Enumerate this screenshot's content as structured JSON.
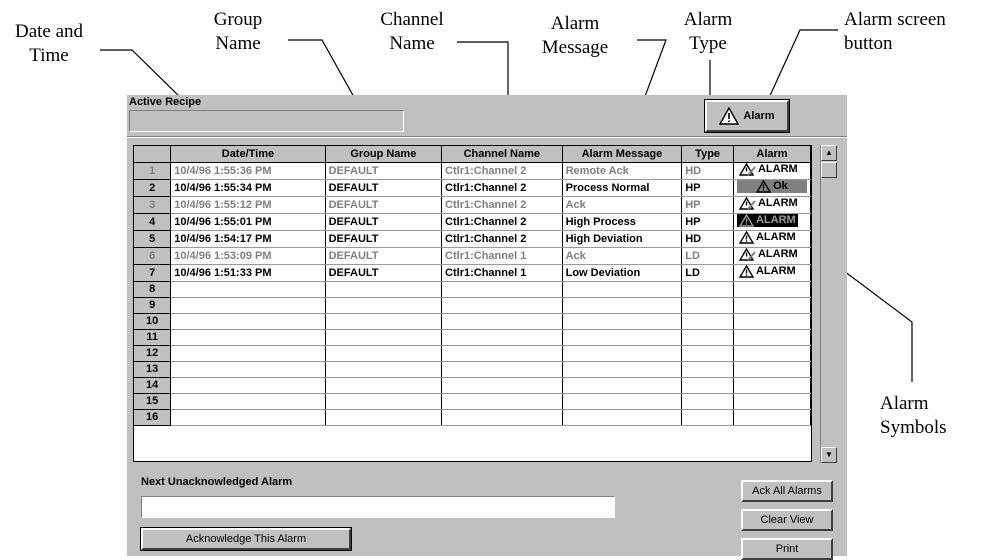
{
  "callouts": {
    "date_time": "Date and Time",
    "group_name": "Group Name",
    "channel_name": "Channel Name",
    "alarm_message": "Alarm Message",
    "alarm_type": "Alarm Type",
    "alarm_screen_button": "Alarm screen button",
    "alarm_symbols": "Alarm Symbols"
  },
  "recipe": {
    "label": "Active Recipe",
    "value": ""
  },
  "alarm_button": {
    "label": "Alarm",
    "icon": "warning-triangle-icon"
  },
  "table": {
    "columns": [
      "",
      "Date/Time",
      "Group Name",
      "Channel Name",
      "Alarm Message",
      "Type",
      "Alarm"
    ],
    "rows": [
      {
        "n": "1",
        "datetime": "10/4/96 1:55:36 PM",
        "group": "DEFAULT",
        "channel": "Ctlr1:Channel 2",
        "message": "Remote Ack",
        "type": "HD",
        "alarm": "ALARM",
        "state": "dim",
        "symbol": "acked"
      },
      {
        "n": "2",
        "datetime": "10/4/96 1:55:34 PM",
        "group": "DEFAULT",
        "channel": "Ctlr1:Channel 2",
        "message": "Process Normal",
        "type": "HP",
        "alarm": "Ok",
        "state": "bright",
        "symbol": "ok"
      },
      {
        "n": "3",
        "datetime": "10/4/96 1:55:12 PM",
        "group": "DEFAULT",
        "channel": "Ctlr1:Channel 2",
        "message": "Ack",
        "type": "HP",
        "alarm": "ALARM",
        "state": "dim",
        "symbol": "acked"
      },
      {
        "n": "4",
        "datetime": "10/4/96 1:55:01 PM",
        "group": "DEFAULT",
        "channel": "Ctlr1:Channel 2",
        "message": "High Process",
        "type": "HP",
        "alarm": "ALARM",
        "state": "bright",
        "symbol": "active-inverse"
      },
      {
        "n": "5",
        "datetime": "10/4/96 1:54:17 PM",
        "group": "DEFAULT",
        "channel": "Ctlr1:Channel 2",
        "message": "High Deviation",
        "type": "HD",
        "alarm": "ALARM",
        "state": "bright",
        "symbol": "active"
      },
      {
        "n": "6",
        "datetime": "10/4/96 1:53:09 PM",
        "group": "DEFAULT",
        "channel": "Ctlr1:Channel 1",
        "message": "Ack",
        "type": "LD",
        "alarm": "ALARM",
        "state": "dim",
        "symbol": "acked"
      },
      {
        "n": "7",
        "datetime": "10/4/96 1:51:33 PM",
        "group": "DEFAULT",
        "channel": "Ctlr1:Channel 1",
        "message": "Low Deviation",
        "type": "LD",
        "alarm": "ALARM",
        "state": "bright",
        "symbol": "active"
      }
    ],
    "empty_rows": [
      "8",
      "9",
      "10",
      "11",
      "12",
      "13",
      "14",
      "15",
      "16"
    ]
  },
  "next_alarm": {
    "label": "Next Unacknowledged Alarm",
    "value": ""
  },
  "buttons": {
    "acknowledge": "Acknowledge This Alarm",
    "ack_all": "Ack All Alarms",
    "clear_view": "Clear View",
    "print": "Print"
  },
  "colors": {
    "window": "#c0c0c0",
    "dim_text": "#808080",
    "ok_fill": "#808080",
    "inverse_fill": "#000000"
  }
}
